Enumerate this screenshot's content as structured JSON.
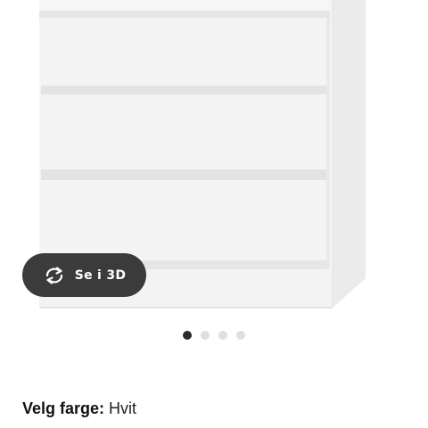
{
  "view3d": {
    "label": "Se i 3D",
    "icon": "rotate-3d-icon"
  },
  "carousel": {
    "count": 4,
    "active_index": 0
  },
  "color_selector": {
    "label": "Velg farge:",
    "value": "Hvit"
  },
  "colors": {
    "button_bg": "#3b3b3b",
    "dot_active": "#2b2b2b",
    "dot_inactive": "#dfdfdf",
    "dresser_white": "#f3f3f3"
  },
  "image": {
    "subject": "white-chest-of-drawers"
  }
}
